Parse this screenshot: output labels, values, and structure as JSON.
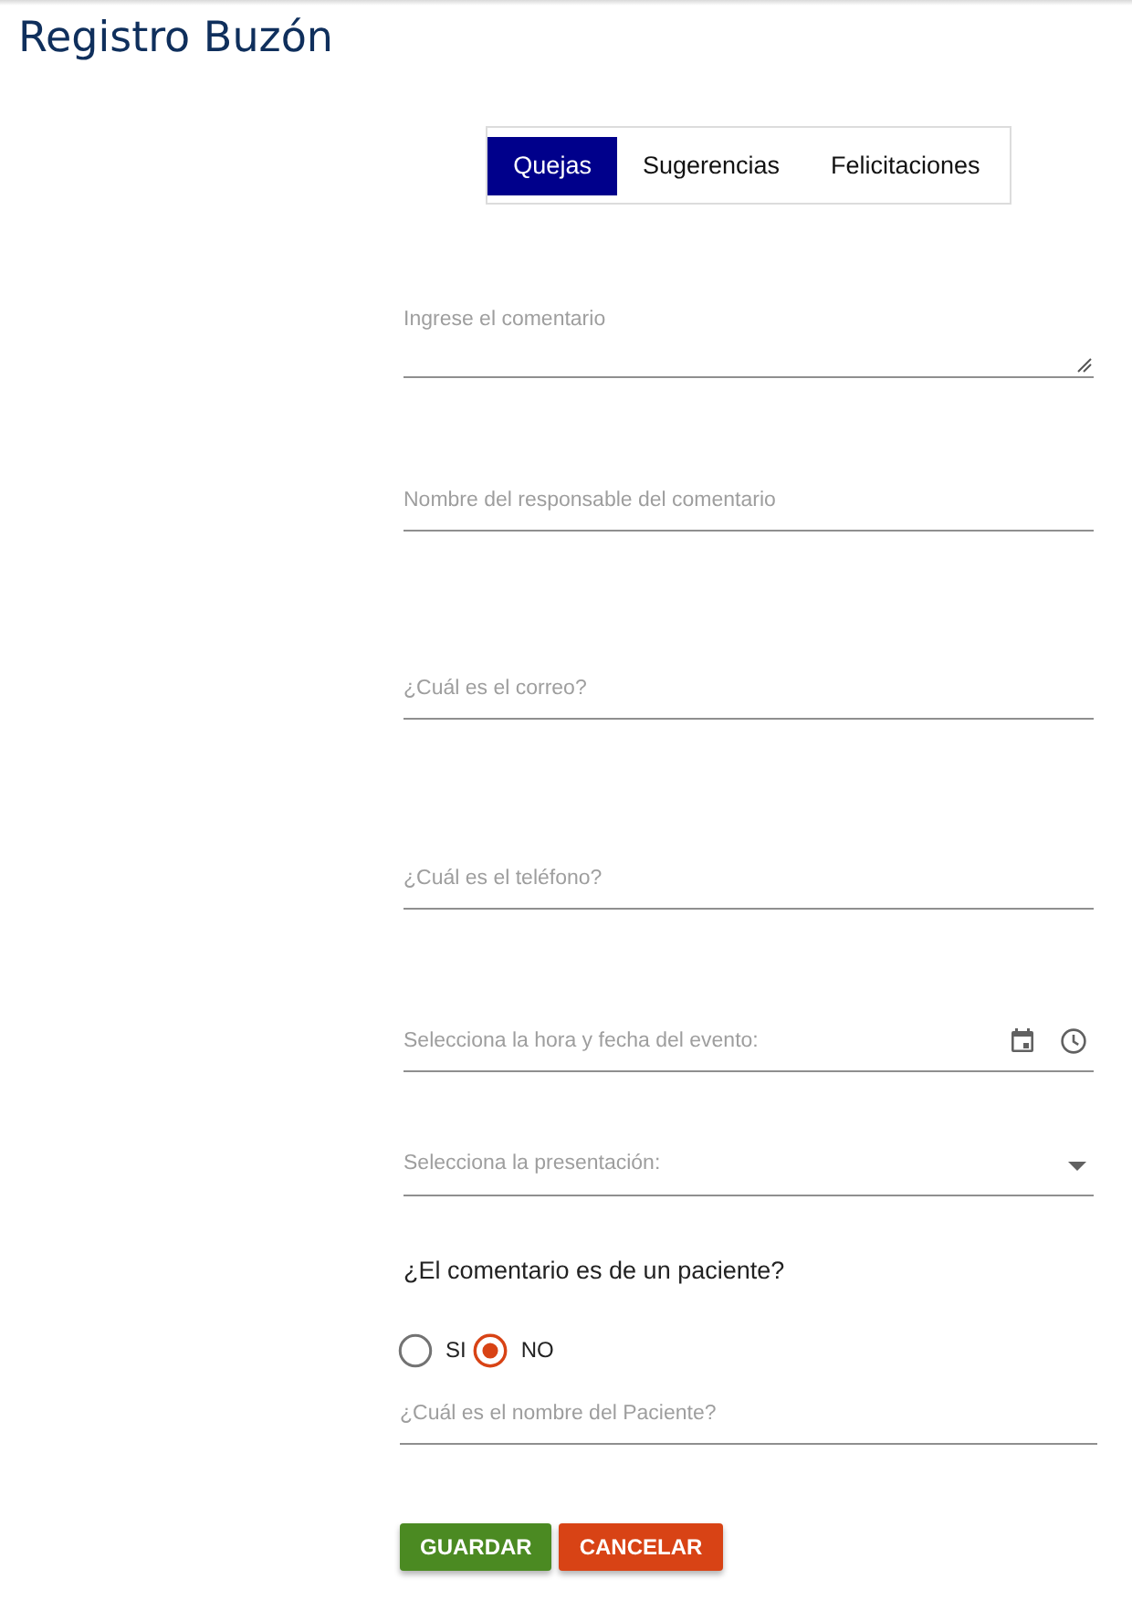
{
  "title": "Registro Buzón",
  "tabs": [
    {
      "label": "Quejas",
      "selected": true
    },
    {
      "label": "Sugerencias",
      "selected": false
    },
    {
      "label": "Felicitaciones",
      "selected": false
    }
  ],
  "fields": [
    {
      "kind": "textarea",
      "placeholder": "Ingrese el comentario"
    },
    {
      "kind": "text",
      "placeholder": "Nombre del responsable del comentario"
    },
    {
      "kind": "text",
      "placeholder": "¿Cuál es el correo?"
    },
    {
      "kind": "text",
      "placeholder": "¿Cuál es el teléfono?"
    },
    {
      "kind": "datetime",
      "placeholder": "Selecciona la hora y fecha del evento:"
    },
    {
      "kind": "select",
      "placeholder": "Selecciona la presentación:"
    }
  ],
  "patient_question": {
    "label": "¿El comentario es de un paciente?",
    "options": [
      {
        "label": "SI",
        "selected": false
      },
      {
        "label": "NO",
        "selected": true
      }
    ]
  },
  "patient_name": {
    "placeholder": "¿Cuál es el nombre del Paciente?"
  },
  "buttons": [
    {
      "label": "GUARDAR",
      "kind": "save"
    },
    {
      "label": "CANCELAR",
      "kind": "cancel"
    }
  ]
}
